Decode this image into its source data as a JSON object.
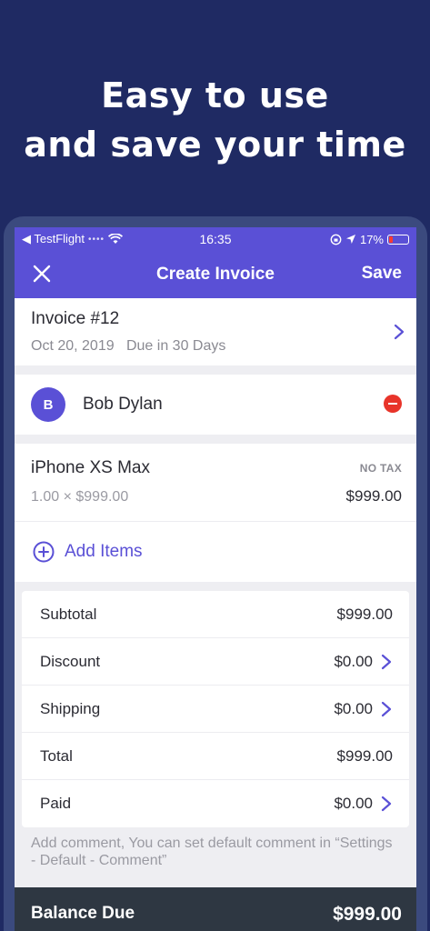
{
  "headline": {
    "line1": "Easy to use",
    "line2": "and save your time"
  },
  "status_bar": {
    "carrier": "◀ TestFlight",
    "time": "16:35",
    "battery": "17%"
  },
  "nav": {
    "title": "Create Invoice",
    "save_label": "Save"
  },
  "invoice": {
    "title": "Invoice #12",
    "date": "Oct 20, 2019",
    "due": "Due in 30 Days"
  },
  "client": {
    "initial": "B",
    "name": "Bob Dylan"
  },
  "items": [
    {
      "name": "iPhone XS Max",
      "qty_price": "1.00 × $999.00",
      "tax": "NO TAX",
      "amount": "$999.00"
    }
  ],
  "add_items_label": "Add Items",
  "totals": {
    "subtotal_label": "Subtotal",
    "subtotal": "$999.00",
    "discount_label": "Discount",
    "discount": "$0.00",
    "shipping_label": "Shipping",
    "shipping": "$0.00",
    "total_label": "Total",
    "total": "$999.00",
    "paid_label": "Paid",
    "paid": "$0.00"
  },
  "comment": "Add comment, You can set default comment in “Settings - Default - Comment”",
  "balance": {
    "label": "Balance Due",
    "value": "$999.00"
  },
  "colors": {
    "background": "#1f2a63",
    "accent": "#5a50d6",
    "danger": "#e8342a",
    "balance_bar": "#2e3742"
  }
}
